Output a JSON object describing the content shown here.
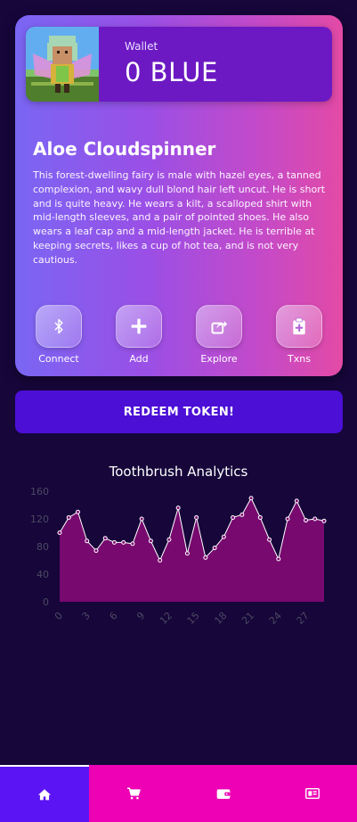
{
  "wallet": {
    "label": "Wallet",
    "amount": "0 BLUE"
  },
  "character": {
    "name": "Aloe Cloudspinner",
    "description": "This forest-dwelling fairy is male with hazel eyes, a tanned complexion, and wavy dull blond hair left uncut. He is short and is quite heavy. He wears a kilt, a scalloped shirt with mid-length sleeves, and a pair of pointed shoes. He also wears a leaf cap and a mid-length jacket. He is terrible at keeping secrets, likes a cup of hot tea, and is not very cautious."
  },
  "actions": [
    {
      "label": "Connect",
      "icon": "bluetooth-icon"
    },
    {
      "label": "Add",
      "icon": "plus-icon"
    },
    {
      "label": "Explore",
      "icon": "share-icon"
    },
    {
      "label": "Txns",
      "icon": "clipboard-plus-icon"
    }
  ],
  "redeem": {
    "label": "REDEEM TOKEN!"
  },
  "chart_data": {
    "type": "area",
    "title": "Toothbrush Analytics",
    "x": [
      0,
      1,
      2,
      3,
      4,
      5,
      6,
      7,
      8,
      9,
      10,
      11,
      12,
      13,
      14,
      15,
      16,
      17,
      18,
      19,
      20,
      21,
      22,
      23,
      24,
      25,
      26,
      27,
      28,
      29
    ],
    "values": [
      100,
      122,
      130,
      88,
      74,
      92,
      86,
      86,
      84,
      120,
      88,
      60,
      90,
      136,
      70,
      122,
      64,
      78,
      94,
      122,
      126,
      150,
      122,
      90,
      62,
      120,
      146,
      118,
      120,
      117
    ],
    "xticks": [
      "0",
      "3",
      "6",
      "9",
      "12",
      "15",
      "18",
      "21",
      "24",
      "27"
    ],
    "yticks": [
      "0",
      "40",
      "80",
      "120",
      "160"
    ],
    "ylim": [
      0,
      160
    ],
    "grid": false,
    "colors": {
      "fill": "#7c0a72",
      "line": "#ffffff",
      "point": "#ffffff",
      "axis_text": "#4b4a62"
    }
  },
  "nav": [
    {
      "name": "home-icon",
      "active": true
    },
    {
      "name": "cart-icon",
      "active": false
    },
    {
      "name": "wallet-icon",
      "active": false
    },
    {
      "name": "ticket-icon",
      "active": false
    }
  ],
  "colors": {
    "background": "#16063a",
    "accent": "#4b0fd6",
    "nav_pink": "#ee00b4",
    "nav_active": "#5b14f4"
  }
}
